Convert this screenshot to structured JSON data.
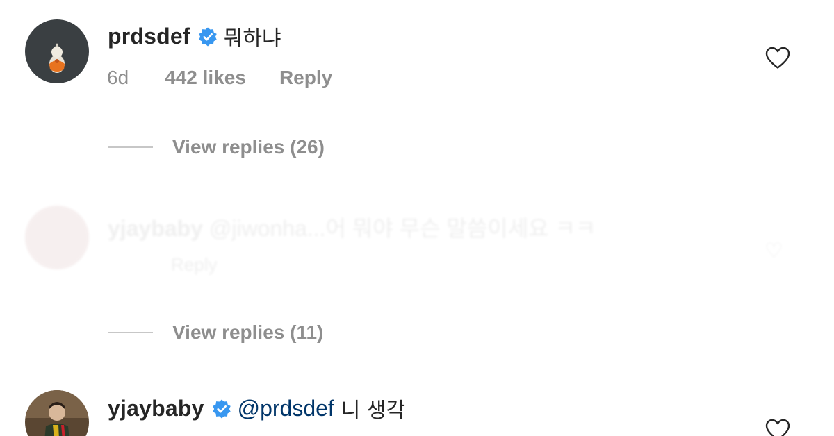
{
  "comments": [
    {
      "username": "prdsdef",
      "text": "뭐하냐",
      "time": "6d",
      "likes": "442 likes",
      "reply_label": "Reply",
      "avatar_bg": "#3a3f42"
    },
    {
      "username": "yjaybaby",
      "mention": "@prdsdef",
      "text": "니 생각"
    }
  ],
  "faded_comment": {
    "username": "yjaybaby",
    "text": "@jiwonha...어 뭐야 무슨 말씀이세요 ㅋㅋ",
    "meta": "Reply"
  },
  "view_replies": [
    {
      "label": "View replies (26)"
    },
    {
      "label": "View replies (11)"
    }
  ],
  "colors": {
    "verified_badge": "#3897f0",
    "muted_text": "#8e8e8e",
    "mention": "#003569"
  },
  "icons": {
    "verified": "verified-badge-icon",
    "like": "heart-outline-icon"
  }
}
